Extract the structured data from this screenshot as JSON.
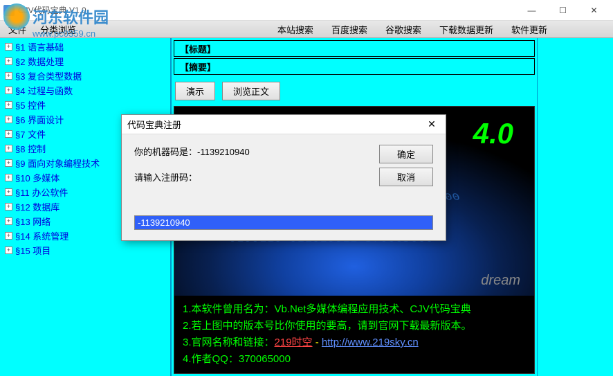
{
  "watermark": {
    "name": "河东软件园",
    "url": "www.pc0359.cn"
  },
  "window": {
    "title": "CJV代码宝典  V1.0"
  },
  "menubar": {
    "file": "文件",
    "browse": "分类浏览",
    "tabs": [
      "本站搜索",
      "百度搜索",
      "谷歌搜索",
      "下载数据更新",
      "软件更新"
    ]
  },
  "sidebar": {
    "items": [
      "§1  语言基础",
      "§2  数据处理",
      "§3  复合类型数据",
      "§4  过程与函数",
      "§5  控件",
      "§6  界面设计",
      "§7  文件",
      "§8  控制",
      "§9  面向对象编程技术",
      "§10  多媒体",
      "§11  办公软件",
      "§12  数据库",
      "§13  网络",
      "§14  系统管理",
      "§15  项目"
    ]
  },
  "info": {
    "title_label": "【标题】",
    "summary_label": "【摘要】"
  },
  "actions": {
    "demo": "演示",
    "browse_text": "浏览正文"
  },
  "viewer": {
    "version": "4.0",
    "dream": "dream",
    "binary_sample": "0100110 011010011 370065000",
    "lines": [
      {
        "prefix": "1.",
        "text": "本软件曾用名为：Vb.Net多媒体编程应用技术、CJV代码宝典"
      },
      {
        "prefix": "2.",
        "text": "若上图中的版本号比你使用的要高，请到官网下载最新版本。"
      },
      {
        "prefix": "3.",
        "label": "官网名称和链接：",
        "highlight": "219时空",
        "dash": " - ",
        "link": "http://www.219sky.cn"
      },
      {
        "prefix": "4.",
        "label": "作者QQ：",
        "value": "370065000"
      }
    ]
  },
  "modal": {
    "title": "代码宝典注册",
    "machine_label": "你的机器码是：",
    "machine_code": "-1139210940",
    "input_label": "请输入注册码：",
    "input_value": "-1139210940",
    "ok": "确定",
    "cancel": "取消"
  }
}
